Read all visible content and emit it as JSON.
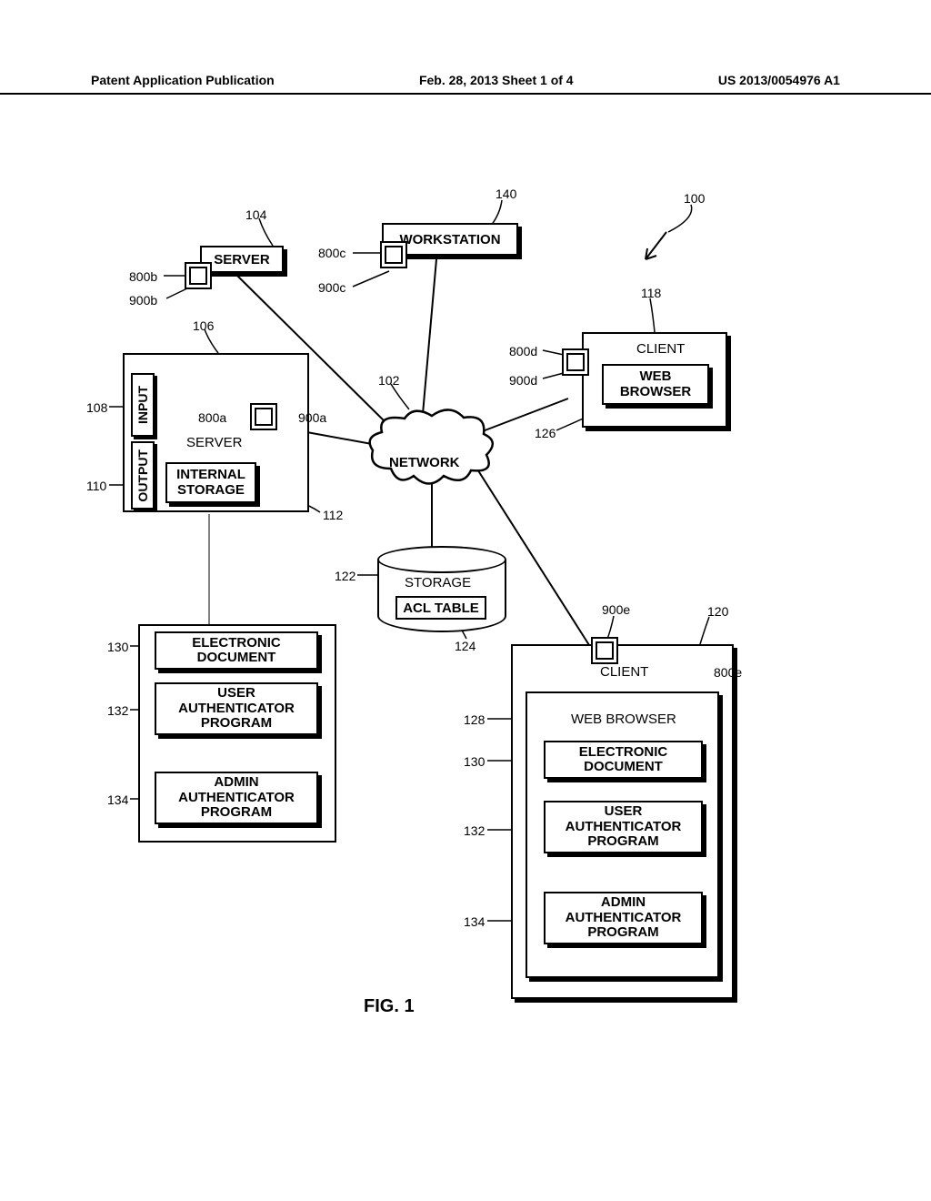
{
  "header": {
    "left": "Patent Application Publication",
    "center": "Feb. 28, 2013  Sheet 1 of 4",
    "right": "US 2013/0054976 A1"
  },
  "figure_caption": "FIG. 1",
  "refs": {
    "r100": "100",
    "r102": "102",
    "r104": "104",
    "r106": "106",
    "r108": "108",
    "r110": "110",
    "r112": "112",
    "r118": "118",
    "r120": "120",
    "r122": "122",
    "r124": "124",
    "r126": "126",
    "r128": "128",
    "r130": "130",
    "r130b": "130",
    "r132": "132",
    "r132b": "132",
    "r134": "134",
    "r134b": "134",
    "r140": "140",
    "r800a": "800a",
    "r800b": "800b",
    "r800c": "800c",
    "r800d": "800d",
    "r800e": "800e",
    "r900a": "900a",
    "r900b": "900b",
    "r900c": "900c",
    "r900d": "900d",
    "r900e": "900e"
  },
  "labels": {
    "workstation": "WORKSTATION",
    "server": "SERVER",
    "server2": "SERVER",
    "input": "INPUT",
    "output": "OUTPUT",
    "internal_storage": "INTERNAL\nSTORAGE",
    "network": "NETWORK",
    "client": "CLIENT",
    "client2": "CLIENT",
    "web_browser": "WEB\nBROWSER",
    "web_browser2": "WEB BROWSER",
    "storage": "STORAGE",
    "acl_table": "ACL TABLE",
    "electronic_document": "ELECTRONIC\nDOCUMENT",
    "electronic_document2": "ELECTRONIC\nDOCUMENT",
    "user_auth": "USER\nAUTHENTICATOR\nPROGRAM",
    "user_auth2": "USER\nAUTHENTICATOR\nPROGRAM",
    "admin_auth": "ADMIN\nAUTHENTICATOR\nPROGRAM",
    "admin_auth2": "ADMIN\nAUTHENTICATOR\nPROGRAM"
  }
}
